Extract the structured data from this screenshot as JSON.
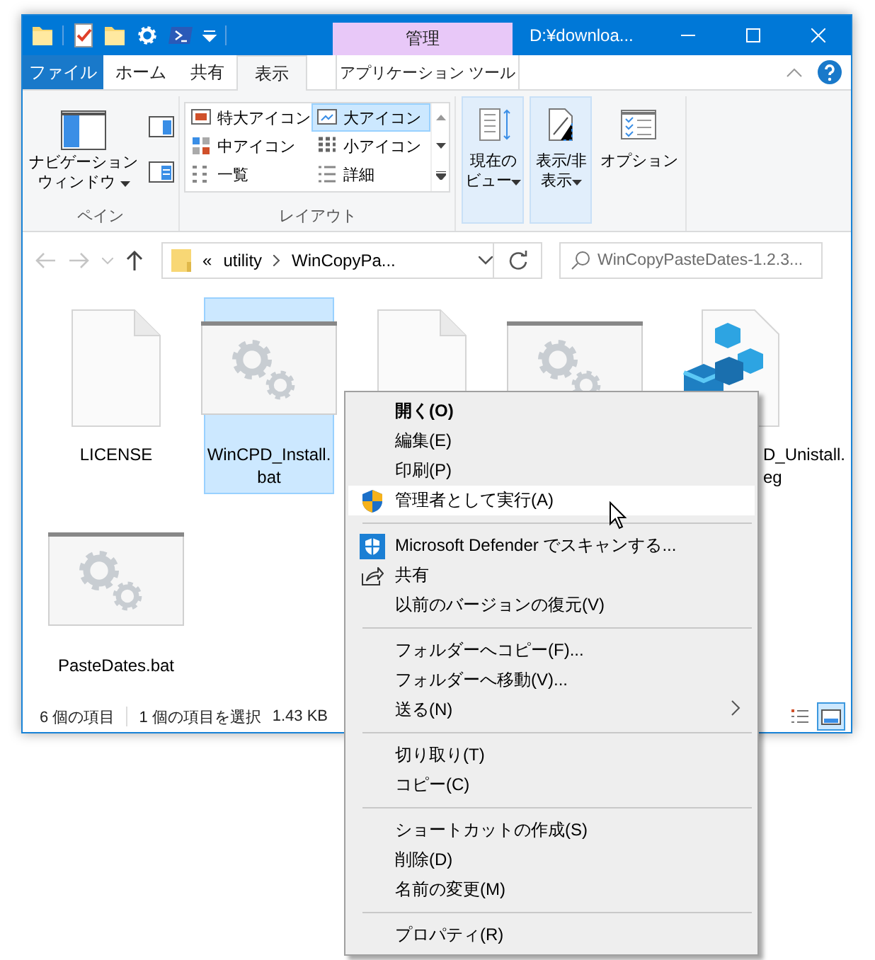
{
  "title_bar": {
    "context_tab": "管理",
    "title": "D:¥downloa..."
  },
  "tabs": [
    {
      "label": "ファイル",
      "kind": "file",
      "selected": false
    },
    {
      "label": "ホーム",
      "kind": "tab",
      "selected": false
    },
    {
      "label": "共有",
      "kind": "tab",
      "selected": false
    },
    {
      "label": "表示",
      "kind": "tab",
      "selected": true
    },
    {
      "label": "アプリケーション ツール",
      "kind": "context",
      "selected": false
    }
  ],
  "ribbon": {
    "pane": {
      "label": "ペイン",
      "button": "ナビゲーションウィンドウ"
    },
    "layout": {
      "label": "レイアウト",
      "options": [
        {
          "label": "特大アイコン",
          "selected": false
        },
        {
          "label": "大アイコン",
          "selected": true
        },
        {
          "label": "中アイコン",
          "selected": false
        },
        {
          "label": "小アイコン",
          "selected": false
        },
        {
          "label": "一覧",
          "selected": false
        },
        {
          "label": "詳細",
          "selected": false
        }
      ]
    },
    "view_buttons": [
      {
        "label": "現在のビュー",
        "kind": "current-view",
        "highlighted": true
      },
      {
        "label": "表示/非表示",
        "kind": "show-hide",
        "highlighted": true
      },
      {
        "label": "オプション",
        "kind": "options",
        "highlighted": false
      }
    ]
  },
  "address_bar": {
    "overflow": "«",
    "segments": [
      "utility",
      "WinCopyPa..."
    ]
  },
  "search": {
    "placeholder": "WinCopyPasteDates-1.2.3..."
  },
  "files": [
    {
      "label": "LICENSE",
      "kind": "document",
      "selected": false
    },
    {
      "label": "WinCPD_Install.bat",
      "kind": "batch",
      "selected": true
    },
    {
      "kind": "document",
      "selected": false
    },
    {
      "kind": "batch",
      "selected": false
    },
    {
      "label": "D_Unistall.\neg",
      "kind": "registry",
      "selected": false
    },
    {
      "label": "PasteDates.bat",
      "kind": "batch",
      "selected": false
    }
  ],
  "status_bar": {
    "items": [
      "6 個の項目",
      "1 個の項目を選択",
      "1.43 KB"
    ],
    "views": [
      {
        "kind": "details",
        "selected": false
      },
      {
        "kind": "large-icons",
        "selected": true
      }
    ]
  },
  "context_menu": {
    "items": [
      {
        "kind": "item",
        "label": "開く(O)",
        "default": true,
        "selected": false
      },
      {
        "kind": "item",
        "label": "編集(E)",
        "default": false,
        "selected": false
      },
      {
        "kind": "item",
        "label": "印刷(P)",
        "default": false,
        "selected": false
      },
      {
        "kind": "uac",
        "label": "管理者として実行(A)",
        "default": false,
        "selected": true
      },
      {
        "kind": "separator"
      },
      {
        "kind": "defender",
        "label": "Microsoft Defender でスキャンする...",
        "default": false,
        "selected": false
      },
      {
        "kind": "share",
        "label": "共有",
        "default": false,
        "selected": false
      },
      {
        "kind": "item",
        "label": "以前のバージョンの復元(V)",
        "default": false,
        "selected": false
      },
      {
        "kind": "separator"
      },
      {
        "kind": "item",
        "label": "フォルダーへコピー(F)...",
        "default": false,
        "selected": false
      },
      {
        "kind": "item",
        "label": "フォルダーへ移動(V)...",
        "default": false,
        "selected": false
      },
      {
        "kind": "submenu",
        "label": "送る(N)",
        "default": false,
        "selected": false
      },
      {
        "kind": "separator"
      },
      {
        "kind": "item",
        "label": "切り取り(T)",
        "default": false,
        "selected": false
      },
      {
        "kind": "item",
        "label": "コピー(C)",
        "default": false,
        "selected": false
      },
      {
        "kind": "separator"
      },
      {
        "kind": "item",
        "label": "ショートカットの作成(S)",
        "default": false,
        "selected": false
      },
      {
        "kind": "item",
        "label": "削除(D)",
        "default": false,
        "selected": false
      },
      {
        "kind": "item",
        "label": "名前の変更(M)",
        "default": false,
        "selected": false
      },
      {
        "kind": "separator"
      },
      {
        "kind": "item",
        "label": "プロパティ(R)",
        "default": false,
        "selected": false
      }
    ]
  }
}
